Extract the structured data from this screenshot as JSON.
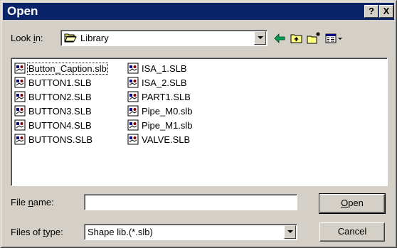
{
  "window": {
    "title": "Open",
    "help_glyph": "?",
    "close_glyph": "X"
  },
  "look_in": {
    "label_pre": "Look ",
    "label_accel": "i",
    "label_post": "n:",
    "value": "Library",
    "icon": "folder-open-icon"
  },
  "toolbar": {
    "back_icon": "back-arrow-icon",
    "up_icon": "up-folder-icon",
    "new_folder_icon": "new-folder-icon",
    "view_icon": "view-menu-icon"
  },
  "files": [
    {
      "name": "Button_Caption.slb",
      "icon": "shape-library-file-icon"
    },
    {
      "name": "BUTTON1.SLB",
      "icon": "shape-library-file-icon"
    },
    {
      "name": "BUTTON2.SLB",
      "icon": "shape-library-file-icon"
    },
    {
      "name": "BUTTON3.SLB",
      "icon": "shape-library-file-icon"
    },
    {
      "name": "BUTTON4.SLB",
      "icon": "shape-library-file-icon"
    },
    {
      "name": "BUTTONS.SLB",
      "icon": "shape-library-file-icon"
    },
    {
      "name": "ISA_1.SLB",
      "icon": "shape-library-file-icon"
    },
    {
      "name": "ISA_2.SLB",
      "icon": "shape-library-file-icon"
    },
    {
      "name": "PART1.SLB",
      "icon": "shape-library-file-icon"
    },
    {
      "name": "Pipe_M0.slb",
      "icon": "shape-library-file-icon"
    },
    {
      "name": "Pipe_M1.slb",
      "icon": "shape-library-file-icon"
    },
    {
      "name": "VALVE.SLB",
      "icon": "shape-library-file-icon"
    }
  ],
  "file_name": {
    "label_pre": "File ",
    "label_accel": "n",
    "label_post": "ame:",
    "value": ""
  },
  "file_type": {
    "label_pre": "Files of ",
    "label_accel": "t",
    "label_post": "ype:",
    "value": "Shape lib.(*.slb)"
  },
  "buttons": {
    "open_accel": "O",
    "open_rest": "pen",
    "cancel": "Cancel"
  },
  "colors": {
    "titlebar": "#0a246a",
    "face": "#d4d0c8",
    "window_bg": "#ffffff"
  }
}
